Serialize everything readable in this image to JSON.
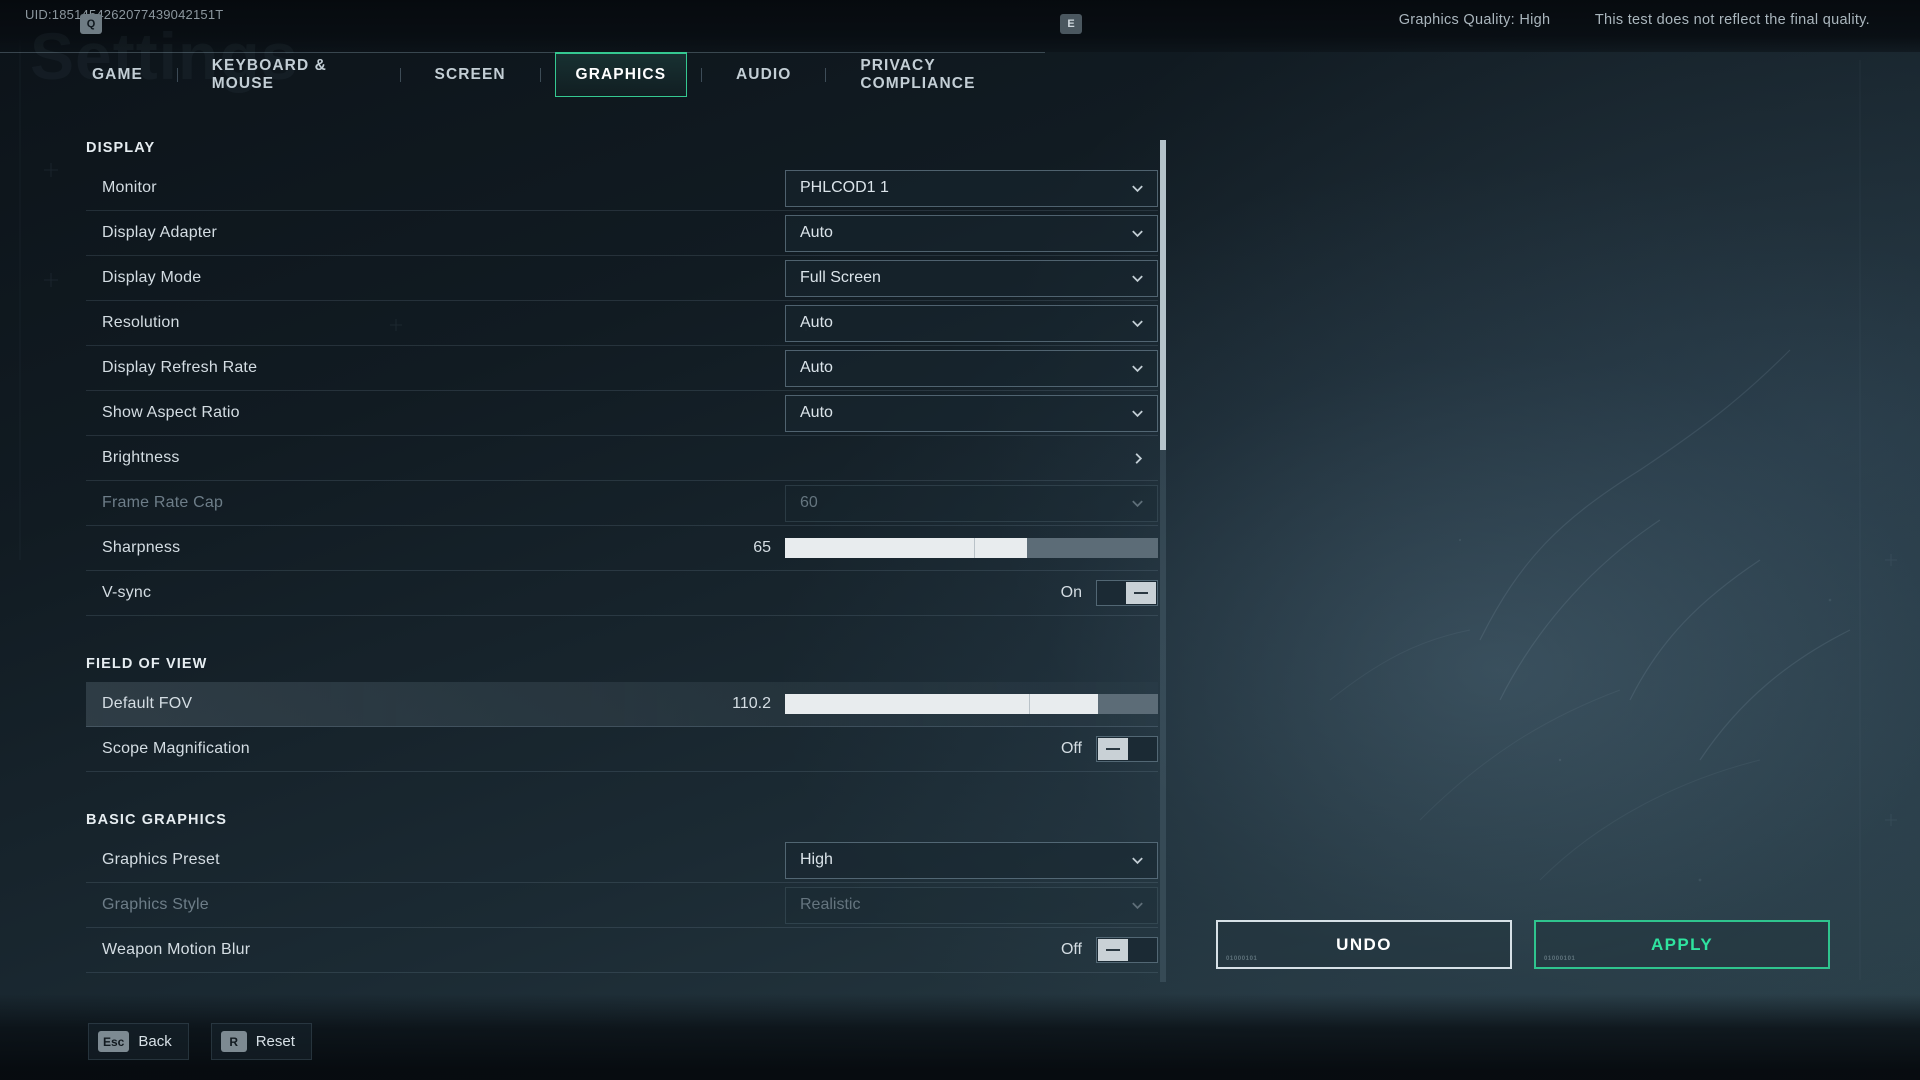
{
  "header": {
    "uid": "UID:1851454262077439042151T",
    "watermark": "Settings",
    "graphics_quality": "Graphics Quality: High",
    "test_note": "This test does not reflect the final quality.",
    "key_prev": "Q",
    "key_next": "E"
  },
  "tabs": [
    {
      "label": "GAME",
      "active": false
    },
    {
      "label": "KEYBOARD & MOUSE",
      "active": false
    },
    {
      "label": "SCREEN",
      "active": false
    },
    {
      "label": "GRAPHICS",
      "active": true
    },
    {
      "label": "AUDIO",
      "active": false
    },
    {
      "label": "PRIVACY COMPLIANCE",
      "active": false
    }
  ],
  "groups": {
    "display": {
      "title": "DISPLAY",
      "rows": [
        {
          "label": "Monitor",
          "type": "dropdown",
          "value": "PHLCOD1 1",
          "disabled": false
        },
        {
          "label": "Display Adapter",
          "type": "dropdown",
          "value": "Auto",
          "disabled": false
        },
        {
          "label": "Display Mode",
          "type": "dropdown",
          "value": "Full Screen",
          "disabled": false
        },
        {
          "label": "Resolution",
          "type": "dropdown",
          "value": "Auto",
          "disabled": false
        },
        {
          "label": "Display Refresh Rate",
          "type": "dropdown",
          "value": "Auto",
          "disabled": false
        },
        {
          "label": "Show Aspect Ratio",
          "type": "dropdown",
          "value": "Auto",
          "disabled": false
        },
        {
          "label": "Brightness",
          "type": "submenu",
          "value": "",
          "disabled": false
        },
        {
          "label": "Frame Rate Cap",
          "type": "dropdown",
          "value": "60",
          "disabled": true
        },
        {
          "label": "Sharpness",
          "type": "slider",
          "value": "65",
          "percent": 65,
          "disabled": false
        },
        {
          "label": "V-sync",
          "type": "toggle",
          "value": "On",
          "disabled": false
        }
      ]
    },
    "field_of_view": {
      "title": "FIELD OF VIEW",
      "rows": [
        {
          "label": "Default FOV",
          "type": "slider",
          "value": "110.2",
          "percent": 84,
          "disabled": false,
          "selected": true
        },
        {
          "label": "Scope Magnification",
          "type": "toggle",
          "value": "Off",
          "disabled": false
        }
      ]
    },
    "basic_graphics": {
      "title": "BASIC GRAPHICS",
      "rows": [
        {
          "label": "Graphics Preset",
          "type": "dropdown",
          "value": "High",
          "disabled": false
        },
        {
          "label": "Graphics Style",
          "type": "dropdown",
          "value": "Realistic",
          "disabled": true
        },
        {
          "label": "Weapon Motion Blur",
          "type": "toggle",
          "value": "Off",
          "disabled": false
        }
      ]
    }
  },
  "actions": {
    "undo": "UNDO",
    "apply": "APPLY",
    "deco": "01000101"
  },
  "footer": {
    "back_key": "Esc",
    "back_label": "Back",
    "reset_key": "R",
    "reset_label": "Reset"
  },
  "colors": {
    "accent_green": "#2fe39f",
    "accent_border": "#35c891",
    "text_primary": "#d4dde3",
    "text_disabled": "#6d7d88"
  }
}
